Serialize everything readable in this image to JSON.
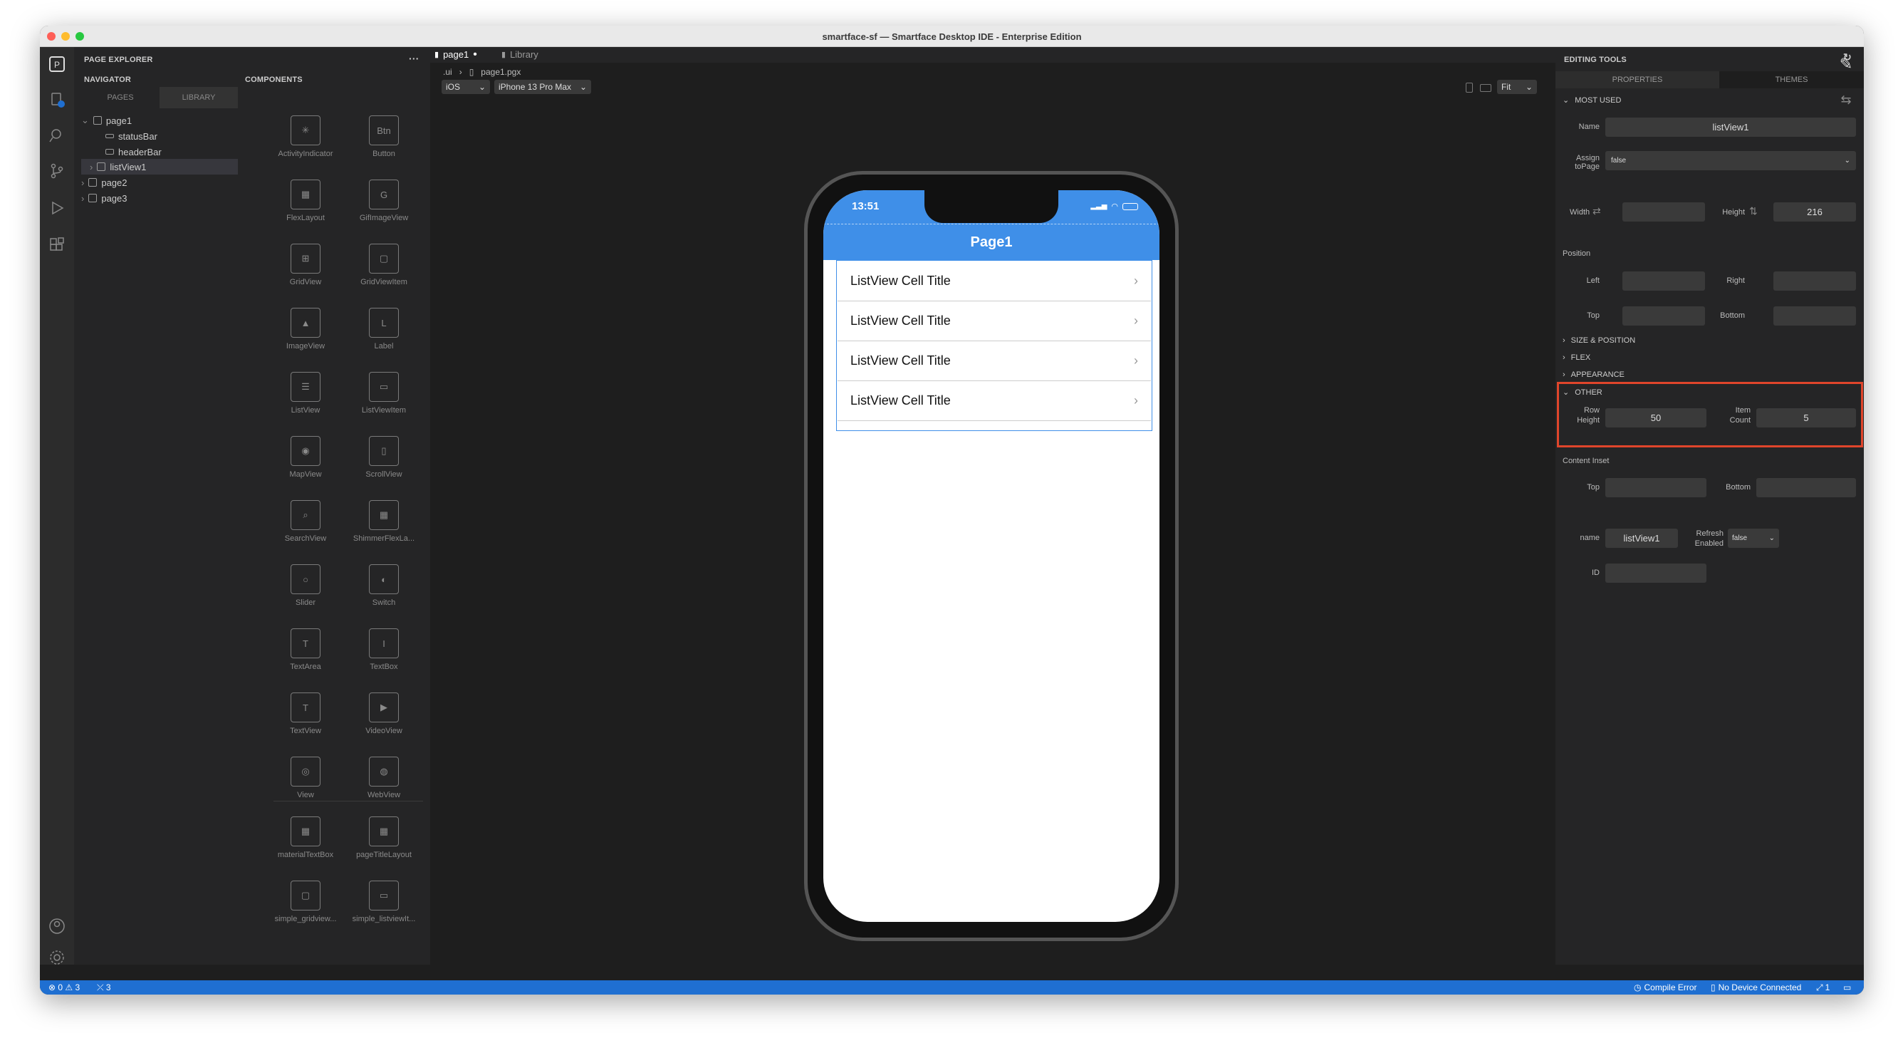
{
  "window": {
    "title": "smartface-sf — Smartface Desktop IDE - Enterprise Edition"
  },
  "explorer": {
    "header": "PAGE EXPLORER",
    "more_icon": "ellipsis-icon",
    "navigator_label": "NAVIGATOR",
    "components_label": "COMPONENTS",
    "tabs": [
      "PAGES",
      "LIBRARY"
    ],
    "tree": [
      {
        "label": "page1"
      },
      {
        "label": "statusBar"
      },
      {
        "label": "headerBar"
      },
      {
        "label": "listView1"
      },
      {
        "label": "page2"
      },
      {
        "label": "page3"
      }
    ],
    "components": [
      {
        "label": "ActivityIndicator",
        "glyph": "✳"
      },
      {
        "label": "Button",
        "glyph": "Btn"
      },
      {
        "label": "FlexLayout",
        "glyph": "▦"
      },
      {
        "label": "GifImageView",
        "glyph": "G"
      },
      {
        "label": "GridView",
        "glyph": "⊞"
      },
      {
        "label": "GridViewItem",
        "glyph": "▢"
      },
      {
        "label": "ImageView",
        "glyph": "▲"
      },
      {
        "label": "Label",
        "glyph": "L"
      },
      {
        "label": "ListView",
        "glyph": "☰"
      },
      {
        "label": "ListViewItem",
        "glyph": "▭"
      },
      {
        "label": "MapView",
        "glyph": "◉"
      },
      {
        "label": "ScrollView",
        "glyph": "▯"
      },
      {
        "label": "SearchView",
        "glyph": "⌕"
      },
      {
        "label": "ShimmerFlexLa...",
        "glyph": "▦"
      },
      {
        "label": "Slider",
        "glyph": "○"
      },
      {
        "label": "Switch",
        "glyph": "◐"
      },
      {
        "label": "TextArea",
        "glyph": "T"
      },
      {
        "label": "TextBox",
        "glyph": "I"
      },
      {
        "label": "TextView",
        "glyph": "T"
      },
      {
        "label": "VideoView",
        "glyph": "▶"
      },
      {
        "label": "View",
        "glyph": "◎"
      },
      {
        "label": "WebView",
        "glyph": "◍"
      }
    ],
    "library_components": [
      {
        "label": "materialTextBox",
        "glyph": "▦"
      },
      {
        "label": "pageTitleLayout",
        "glyph": "▦"
      },
      {
        "label": "simple_gridview...",
        "glyph": "▢"
      },
      {
        "label": "simple_listviewIt...",
        "glyph": "▭"
      }
    ]
  },
  "editor": {
    "tabs": [
      {
        "label": "page1",
        "dirty": true
      },
      {
        "label": "Library"
      }
    ],
    "breadcrumb": [
      ".ui",
      "page1.pgx"
    ],
    "platform": "iOS",
    "device": "iPhone 13 Pro Max",
    "zoom": "Fit"
  },
  "phone": {
    "time": "13:51",
    "page_title": "Page1",
    "header_color": "#3f8fe8",
    "cells": [
      "ListView Cell Title",
      "ListView Cell Title",
      "ListView Cell Title",
      "ListView Cell Title"
    ]
  },
  "props": {
    "header": "EDITING TOOLS",
    "tabs": [
      "PROPERTIES",
      "THEMES"
    ],
    "most_used": "MOST USED",
    "name_label": "Name",
    "name_value": "listView1",
    "assign_label": "Assign toPage",
    "assign_value": "false",
    "width_label": "Width",
    "width_value": "",
    "height_label": "Height",
    "height_value": "216",
    "position_label": "Position",
    "left_label": "Left",
    "right_label": "Right",
    "top_label": "Top",
    "bottom_label": "Bottom",
    "sections": [
      "SIZE & POSITION",
      "FLEX",
      "APPEARANCE"
    ],
    "other": "OTHER",
    "row_height_label": "Row Height",
    "row_height_value": "50",
    "item_count_label": "Item Count",
    "item_count_value": "5",
    "content_inset_label": "Content Inset",
    "ci_top_label": "Top",
    "ci_bottom_label": "Bottom",
    "name2_label": "name",
    "name2_value": "listView1",
    "refresh_label": "Refresh Enabled",
    "refresh_value": "false",
    "id_label": "ID",
    "highlight_color": "#e0452b"
  },
  "status": {
    "problems": "⊗ 0 ⚠ 3",
    "tools": "⤫ 3",
    "compile": "Compile Error",
    "device": "No Device Connected",
    "count": "1"
  }
}
